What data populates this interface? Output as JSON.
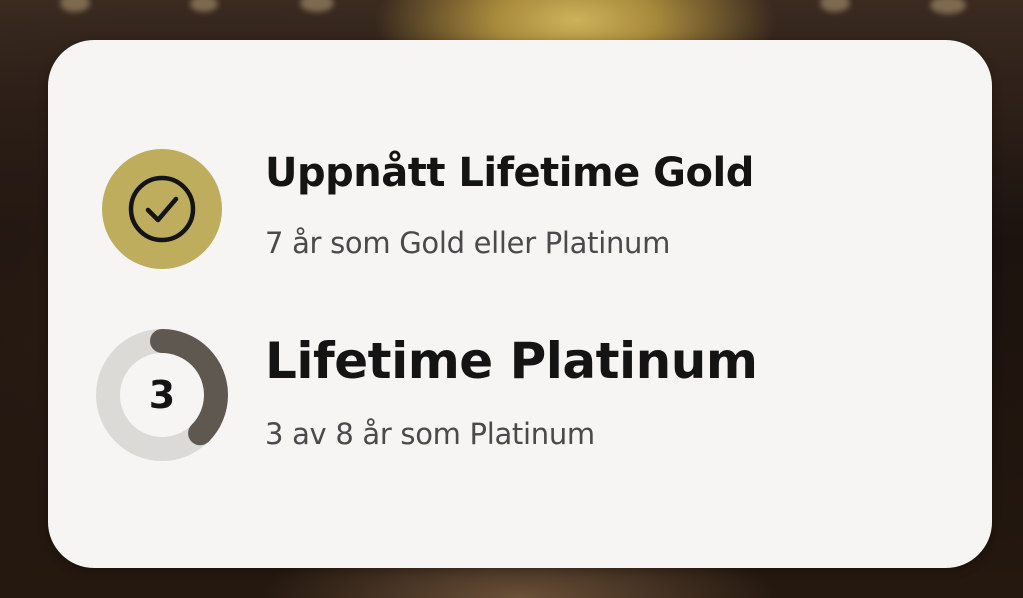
{
  "achievements": {
    "gold": {
      "title": "Uppnått Lifetime Gold",
      "subtitle": "7 år som Gold eller Platinum",
      "icon": "check-circle-icon",
      "badge_color": "#bfad5e"
    },
    "platinum": {
      "title": "Lifetime Platinum",
      "subtitle": "3 av 8 år som Platinum",
      "progress_current": "3",
      "progress_total": 8,
      "progress_fraction": 0.375,
      "ring_track_color": "#dcdad6",
      "ring_fill_color": "#5e5851"
    }
  },
  "colors": {
    "card_background": "#f6f5f3",
    "text_primary": "#141414",
    "text_secondary": "#4a4a4a"
  }
}
